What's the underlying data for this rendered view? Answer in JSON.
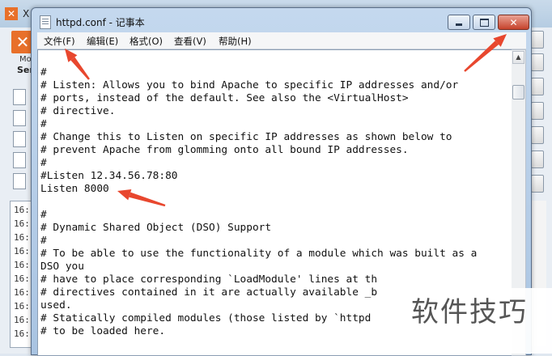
{
  "background_app": {
    "title": "X",
    "label_module": "Mo",
    "label_service": "Ser",
    "log_lines": [
      "16:",
      "16:",
      "16:",
      "16:",
      "16:",
      "16:",
      "16:",
      "16:",
      "16:",
      "16:"
    ]
  },
  "notepad": {
    "title": "httpd.conf - 记事本",
    "menu": [
      "文件(F)",
      "编辑(E)",
      "格式(O)",
      "查看(V)",
      "帮助(H)"
    ],
    "lines": [
      "#",
      "# Listen: Allows you to bind Apache to specific IP addresses and/or",
      "# ports, instead of the default. See also the <VirtualHost>",
      "# directive.",
      "#",
      "# Change this to Listen on specific IP addresses as shown below to",
      "# prevent Apache from glomming onto all bound IP addresses.",
      "#",
      "#Listen 12.34.56.78:80",
      "Listen 8000",
      "",
      "#",
      "# Dynamic Shared Object (DSO) Support",
      "#",
      "# To be able to use the functionality of a module which was built as a",
      "DSO you",
      "# have to place corresponding `LoadModule' lines at th",
      "# directives contained in it are actually available _b",
      "used.",
      "# Statically compiled modules (those listed by `httpd",
      "# to be loaded here."
    ]
  },
  "annotation_color": "#e8472e",
  "watermark": "软件技巧"
}
